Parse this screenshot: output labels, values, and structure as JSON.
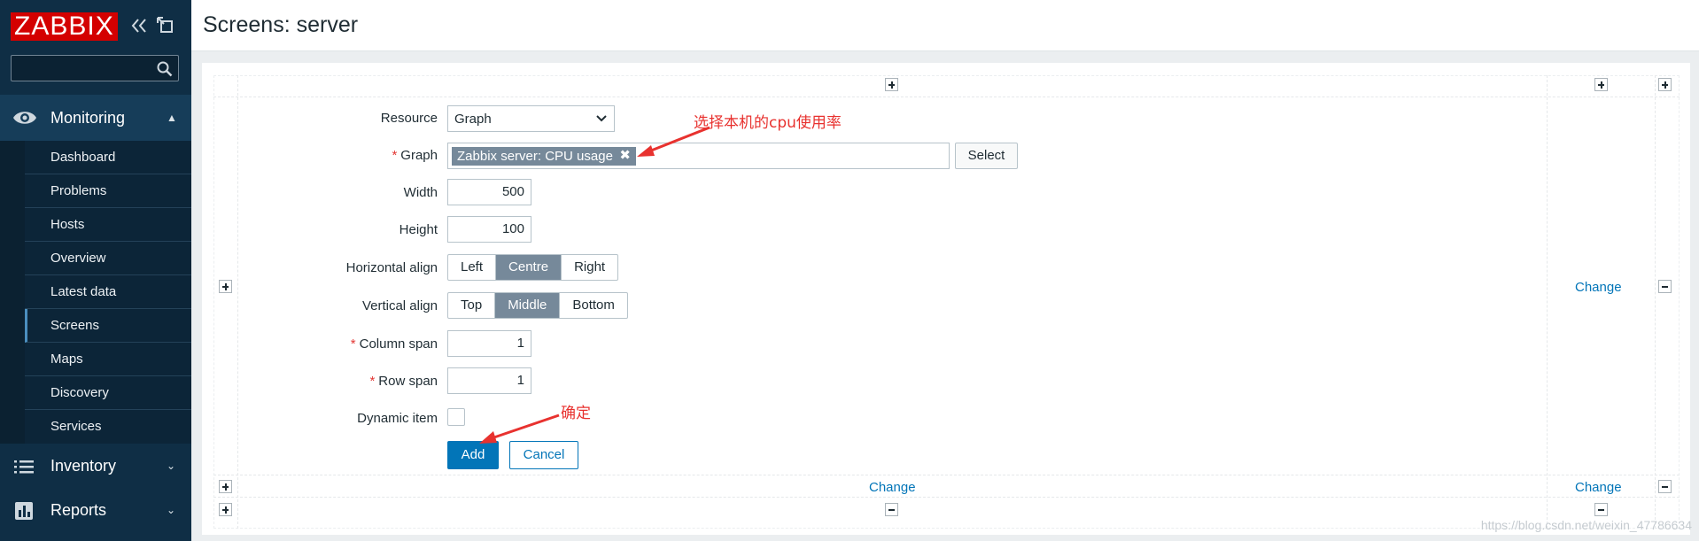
{
  "app": {
    "logo_text": "ZABBIX",
    "brand_color": "#d40000",
    "sidebar_color": "#0f2e45",
    "accent_color": "#0275b8"
  },
  "sidebar": {
    "search": {
      "value": "",
      "placeholder": ""
    },
    "sections": [
      {
        "label": "Monitoring",
        "icon": "eye-icon",
        "expanded": true
      },
      {
        "label": "Inventory",
        "icon": "list-icon",
        "expanded": false
      },
      {
        "label": "Reports",
        "icon": "bar-chart-icon",
        "expanded": false
      }
    ],
    "monitoring_items": [
      {
        "label": "Dashboard"
      },
      {
        "label": "Problems"
      },
      {
        "label": "Hosts"
      },
      {
        "label": "Overview"
      },
      {
        "label": "Latest data"
      },
      {
        "label": "Screens",
        "active": true
      },
      {
        "label": "Maps"
      },
      {
        "label": "Discovery"
      },
      {
        "label": "Services"
      }
    ]
  },
  "header": {
    "title": "Screens: server"
  },
  "grid": {
    "change_label": "Change"
  },
  "form": {
    "resource": {
      "label": "Resource",
      "value": "Graph"
    },
    "graph": {
      "label": "Graph",
      "selected": "Zabbix server: CPU usage",
      "select_button": "Select"
    },
    "width": {
      "label": "Width",
      "value": "500"
    },
    "height": {
      "label": "Height",
      "value": "100"
    },
    "horizontal_align": {
      "label": "Horizontal align",
      "options": [
        "Left",
        "Centre",
        "Right"
      ],
      "selected": "Centre"
    },
    "vertical_align": {
      "label": "Vertical align",
      "options": [
        "Top",
        "Middle",
        "Bottom"
      ],
      "selected": "Middle"
    },
    "column_span": {
      "label": "Column span",
      "value": "1"
    },
    "row_span": {
      "label": "Row span",
      "value": "1"
    },
    "dynamic_item": {
      "label": "Dynamic item",
      "checked": false
    },
    "add_button": "Add",
    "cancel_button": "Cancel",
    "required_mark": "*"
  },
  "annotations": {
    "select_cpu": "选择本机的cpu使用率",
    "confirm": "确定"
  },
  "watermark": "https://blog.csdn.net/weixin_47786634"
}
